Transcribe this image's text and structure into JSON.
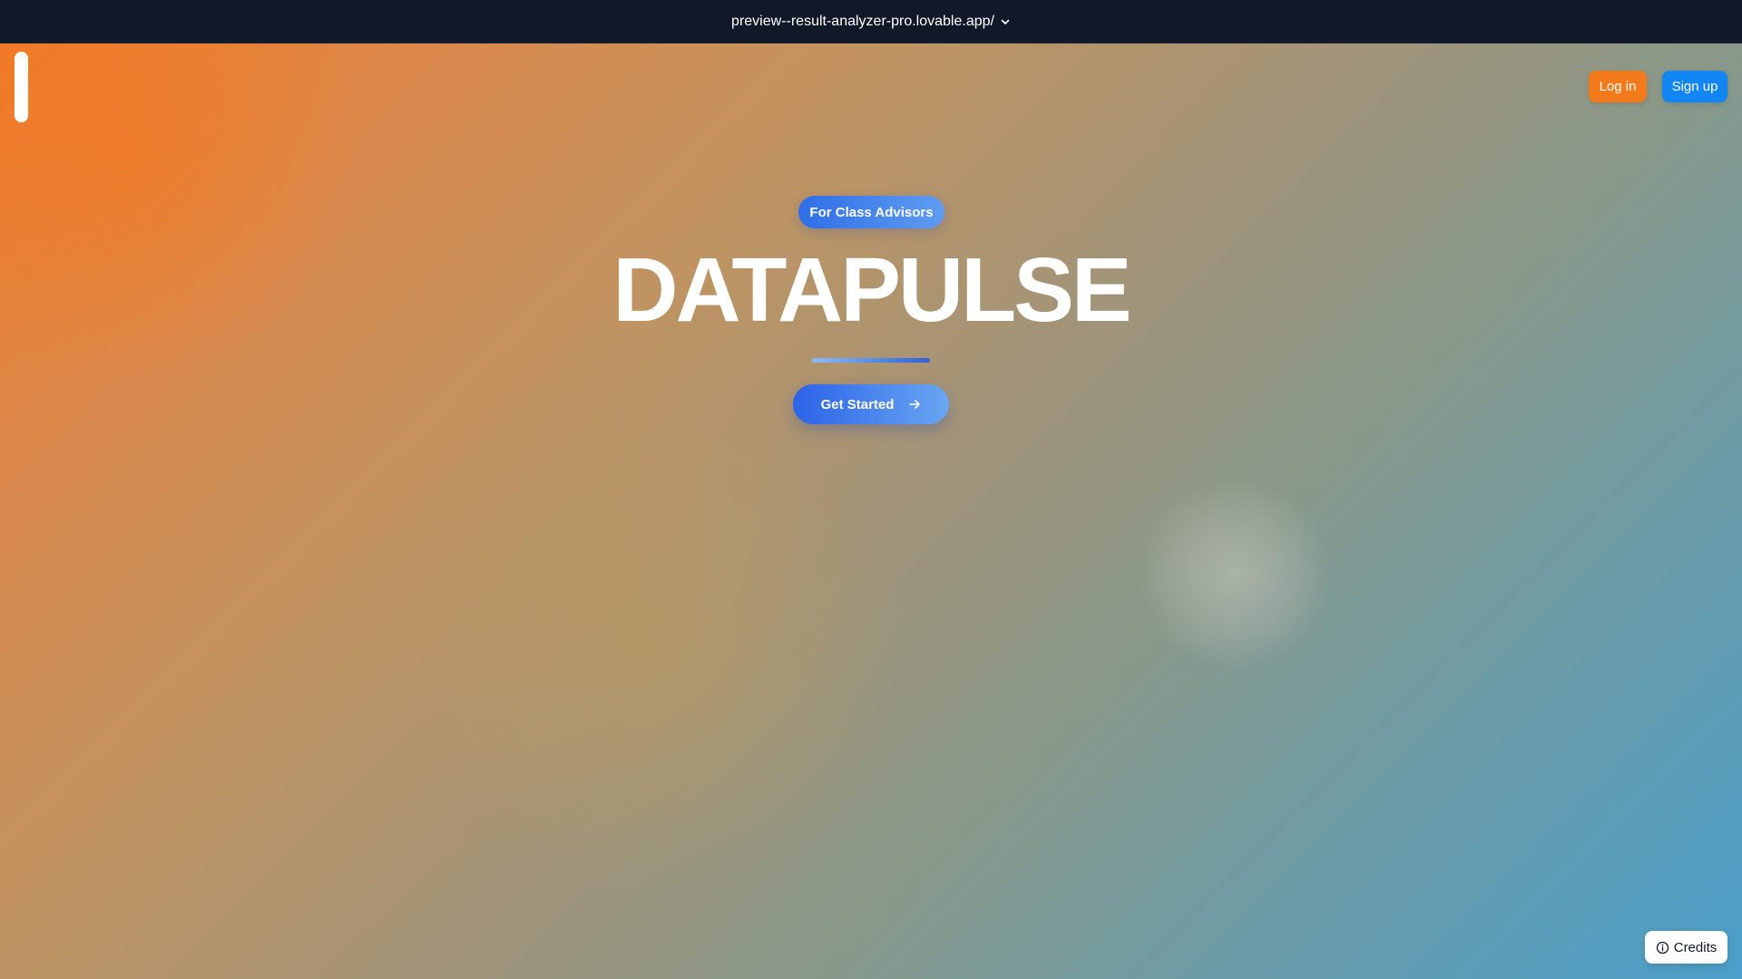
{
  "browser": {
    "url": "preview--result-analyzer-pro.lovable.app/",
    "dropdown_icon": "chevron-down-icon"
  },
  "header": {
    "login_label": "Log in",
    "signup_label": "Sign up",
    "login_color": "#f27a1a",
    "signup_color": "#1185f2"
  },
  "hero": {
    "badge": "For Class Advisors",
    "title": "DATAPULSE",
    "cta_label": "Get Started",
    "cta_icon": "arrow-right-icon"
  },
  "footer": {
    "credits_label": "Credits",
    "credits_icon": "info-icon"
  },
  "colors": {
    "gradient_start": "#f07a28",
    "gradient_end": "#4b9fcb",
    "topbar": "#111827",
    "accent_blue": "#2f6ee8"
  }
}
